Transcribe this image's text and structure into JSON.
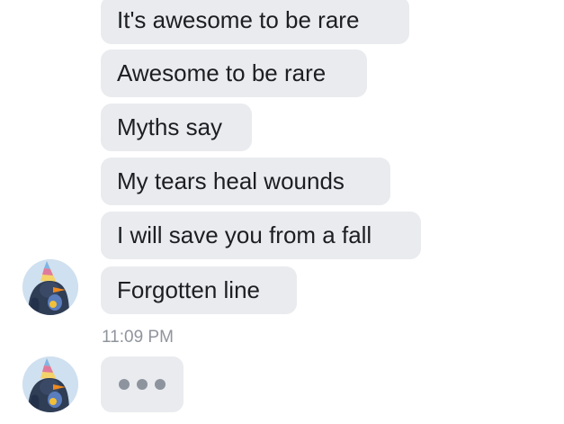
{
  "conversation": {
    "messages": [
      {
        "text": "It's awesome to be rare"
      },
      {
        "text": "Awesome to be rare"
      },
      {
        "text": "Myths say"
      },
      {
        "text": "My tears heal wounds"
      },
      {
        "text": "I will save you from a fall"
      },
      {
        "text": "Forgotten line"
      }
    ],
    "timestamp": "11:09 PM",
    "typing_indicator": {
      "icon": "typing-dots-icon"
    },
    "avatar": {
      "icon": "penguin-avatar-icon"
    }
  },
  "colors": {
    "bubble_background": "#e9ebee",
    "bubble_text": "#1c1e21",
    "timestamp_text": "#90949c",
    "typing_dot": "#8d949e"
  }
}
